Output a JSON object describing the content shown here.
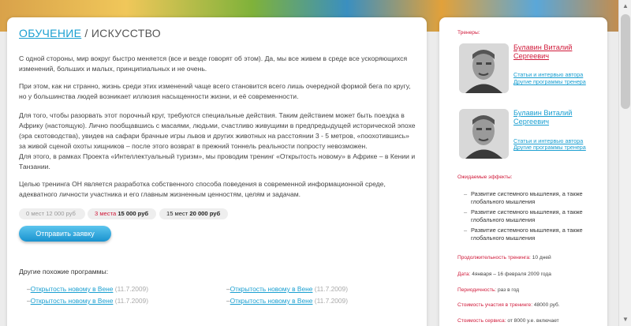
{
  "header": {
    "breadcrumb_link": "ОБУЧЕНИЕ",
    "separator": " / ",
    "section": "ИСКУССТВО"
  },
  "article": {
    "p1": "С одной стороны, мир вокруг быстро меняется (все и везде говорят об этом). Да, мы все живем в среде все ускоряющихся изменений, больших и малых, принципиальных и не очень.",
    "p2": "При этом, как ни странно, жизнь среди этих изменений чаще всего становится всего лишь очередной формой бега по кругу, но у большинства людей возникает иллюзия насыщенности жизни, и её современности.",
    "p3a": "Для того, чтобы разорвать этот порочный круг, требуются специальные действия. Таким действием может быть поездка в Африку (настоящую). Лично пообщавшись с масаями, людьми, счастливо живущими в предпредыдущей исторической эпохе (эра скотоводства), увидев на сафари брачные игры львов и других животных на расстоянии 3 - 5 метров, «поохотившись» за живой сценой охоты хищников – после этого возврат в прежний тоннель реальности попросту невозможен.",
    "p3b": "Для этого, в рамках Проекта «Интеллектуальный туризм», мы проводим тренинг «Открытость новому» в Африке – в Кении и Танзании.",
    "p4": "Целью тренинга ОН является разработка собственного способа поведения в современной информационной среде, адекватного личности участника и его главным жизненным ценностям, целям и задачам."
  },
  "prices": [
    {
      "seats": "0 мест",
      "price": "12 000 руб"
    },
    {
      "seats": "3 места",
      "price": "15 000 руб"
    },
    {
      "seats": "15 мест",
      "price": "20 000 руб"
    }
  ],
  "apply_button": "Отправить заявку",
  "similar": {
    "title": "Другие похожие программы:",
    "items": [
      {
        "link": "Открытость новому в Вене",
        "date": " (11.7.2009)"
      },
      {
        "link": "Открытость новому в Вене",
        "date": " (11.7.2009)"
      },
      {
        "link": "Открытость новому в Вене",
        "date": " (11.7.2009)"
      },
      {
        "link": "Открытость новому в Вене",
        "date": " (11.7.2009)"
      }
    ]
  },
  "sidebar": {
    "trainers_label": "Тренеры:",
    "trainers": [
      {
        "name": "Булавин Виталий Сергеевич",
        "link1": "Статьи и интервью автора",
        "link2": "Другие программы тренера"
      },
      {
        "name": "Булавин Виталий Сергеевич",
        "link1": "Статьи и интервью автора",
        "link2": "Другие программы тренера"
      }
    ],
    "effects_label": "Ожидаемые эффекты:",
    "effects": [
      "Развитие системного мышления, а также глобального мышления",
      "Развитие системного мышления, а также глобального мышления",
      "Развитие системного мышления, а также глобального мышления"
    ],
    "duration_label": "Продолжительность тренинга:",
    "duration_value": "10 дней",
    "date_label": "Дата:",
    "date_value": "4января – 16 февраля 2009 года",
    "freq_label": "Периодичность:",
    "freq_value": "раз в год",
    "cost_label": "Стоимость участия в тренинге:",
    "cost_value": "48000 руб.",
    "service_label": "Стоимость сервиса:",
    "service_value": "от 8000 у.е. включает"
  }
}
